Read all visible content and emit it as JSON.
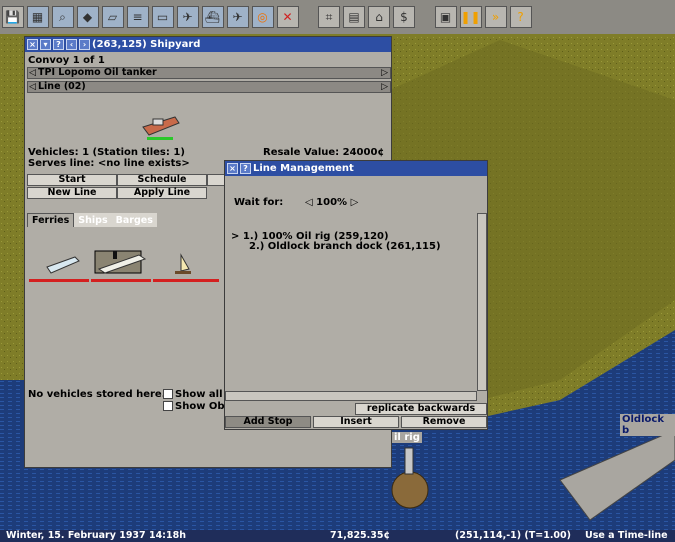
{
  "toolbar": {
    "icons": [
      "save-icon",
      "map-icon",
      "zoom-icon",
      "terrain-icon",
      "road-icon",
      "rail-icon",
      "tram-icon",
      "airplane-icon",
      "ship-icon",
      "jet-icon",
      "station-icon",
      "remove-icon",
      "schedule-icon",
      "list-icon",
      "headquarters-icon",
      "finance-icon",
      "screenshot-icon",
      "pause-icon",
      "fast-forward-icon",
      "help-icon"
    ]
  },
  "depot": {
    "title": "(263,125) Shipyard",
    "convoy_line": "Convoy 1 of 1",
    "vehicle_name": "TPI Lopomo Oil tanker",
    "line_name": "Line (02)",
    "vehicles_info": "Vehicles: 1 (Station tiles: 1)",
    "resale": "Resale Value: 24000¢",
    "serves_line": "Serves line: <no line exists>",
    "buttons": {
      "start": "Start",
      "schedule": "Schedule",
      "new_line": "New Line",
      "apply_line": "Apply Line"
    },
    "tabs": [
      "Ferries",
      "Ships",
      "Barges"
    ],
    "no_vehicles": "No vehicles stored here.",
    "show_all": "Show all",
    "show_obsolete": "Show Ob"
  },
  "line_mgmt": {
    "title": "Line Management",
    "wait_label": "Wait for:",
    "wait_value": "100%",
    "stops": [
      "> 1.) 100% Oil rig (259,120)",
      "2.) Oldlock branch dock (261,115)"
    ],
    "replicate": "replicate backwards",
    "add_stop": "Add Stop",
    "insert": "Insert",
    "remove": "Remove"
  },
  "map_labels": {
    "oil_rig": "il rig",
    "oldlock": "Oldlock b"
  },
  "status": {
    "date": "Winter, 15. February 1937 14:18h",
    "money": "71,825.35¢",
    "coords": "(251,114,-1) (T=1.00)",
    "hint": "Use a Time-line"
  },
  "colors": {
    "title_bar": "#2d4ea3",
    "panel": "#b0ada6",
    "grass": "#7f7d28",
    "water": "#1d3c7a",
    "status_bar": "#1f2d5a"
  }
}
